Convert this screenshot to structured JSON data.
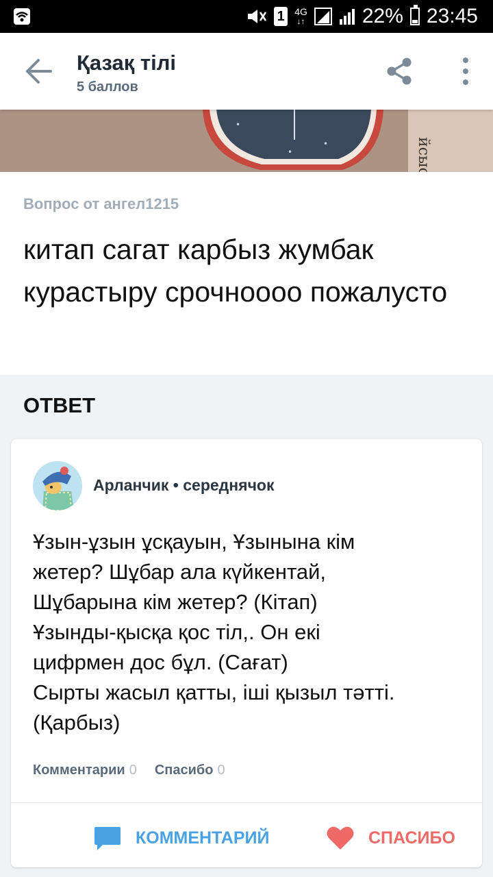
{
  "status_bar": {
    "battery": "22%",
    "time": "23:45",
    "sim_slot": "1",
    "network": "4G"
  },
  "header": {
    "title": "Қазақ тілі",
    "subtitle": "5 баллов",
    "back_icon": "arrow-left-icon",
    "share_icon": "share-icon",
    "more_icon": "more-vertical-icon"
  },
  "question": {
    "author_line": "Вопрос от ангел1215",
    "text": "китап сагат карбыз жумбак курастыру срочнoooo пожалусто"
  },
  "answer_section": {
    "heading": "ОТВЕТ"
  },
  "answer": {
    "author": "Арланчик",
    "rank": "середнячок",
    "text_lines": [
      "Ұзын-ұзын ұсқауын, Ұзынына кім",
      "жетер? Шұбар ала күйкентай,",
      "Шұбарына кім жетер? (Кітап)",
      "Ұзынды-қысқа қос тіл,. Он екі",
      "цифрмен дос бұл. (Сағат)",
      "Сырты жасыл қатты, іші қызыл тәтті.",
      "(Қарбыз)"
    ],
    "comments_label": "Комментарии",
    "comments_count": "0",
    "thanks_label": "Спасибо",
    "thanks_count": "0",
    "comment_button": "КОММЕНТАРИЙ",
    "thanks_button": "СПАСИБО"
  },
  "colors": {
    "accent_blue": "#4aa2e4",
    "accent_red": "#ef6a66",
    "background": "#f0f3f6"
  }
}
